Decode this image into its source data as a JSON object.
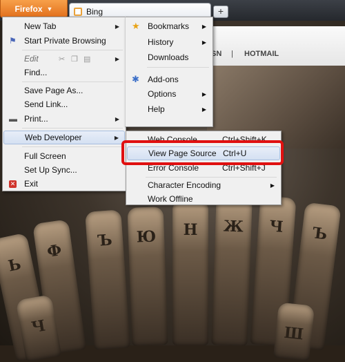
{
  "browser": {
    "menu_button_label": "Firefox",
    "tab_title": "Bing",
    "new_tab_symbol": "+"
  },
  "background_page": {
    "nav_items": [
      "SN",
      "|",
      "HOTMAIL"
    ]
  },
  "main_menu": {
    "items": [
      {
        "label": "New Tab",
        "submenu": true
      },
      {
        "label": "Start Private Browsing",
        "icon": "private-browsing-icon"
      },
      {
        "label": "Edit",
        "disabled": true,
        "submenu": true,
        "icons": [
          "cut-icon",
          "copy-icon",
          "paste-icon"
        ]
      },
      {
        "label": "Find..."
      },
      {
        "label": "Save Page As..."
      },
      {
        "label": "Send Link..."
      },
      {
        "label": "Print...",
        "icon": "print-icon",
        "submenu": true
      },
      {
        "label": "Web Developer",
        "submenu": true,
        "highlighted": true
      },
      {
        "label": "Full Screen"
      },
      {
        "label": "Set Up Sync..."
      },
      {
        "label": "Exit",
        "icon": "exit-icon"
      }
    ]
  },
  "right_menu": {
    "items": [
      {
        "label": "Bookmarks",
        "icon": "star-icon",
        "submenu": true
      },
      {
        "label": "History",
        "submenu": true
      },
      {
        "label": "Downloads"
      },
      {
        "label": "Add-ons",
        "icon": "puzzle-icon"
      },
      {
        "label": "Options",
        "submenu": true
      },
      {
        "label": "Help",
        "submenu": true
      }
    ]
  },
  "web_developer_submenu": {
    "items": [
      {
        "label": "Web Console",
        "shortcut": "Ctrl+Shift+K"
      },
      {
        "label": "View Page Source",
        "shortcut": "Ctrl+U",
        "highlighted": true
      },
      {
        "label": "Error Console",
        "shortcut": "Ctrl+Shift+J"
      },
      {
        "label": "Character Encoding",
        "submenu": true
      },
      {
        "label": "Work Offline"
      }
    ]
  },
  "colors": {
    "firefox_button": "#e2701c",
    "highlight_box": "#e01010",
    "menu_bg": "#f0f0f0"
  },
  "key_glyphs": [
    "Ь",
    "Ф",
    "Ъ",
    "Ю",
    "Н",
    "Ж",
    "Ч",
    "Ъ",
    "Ч",
    "Ш"
  ]
}
